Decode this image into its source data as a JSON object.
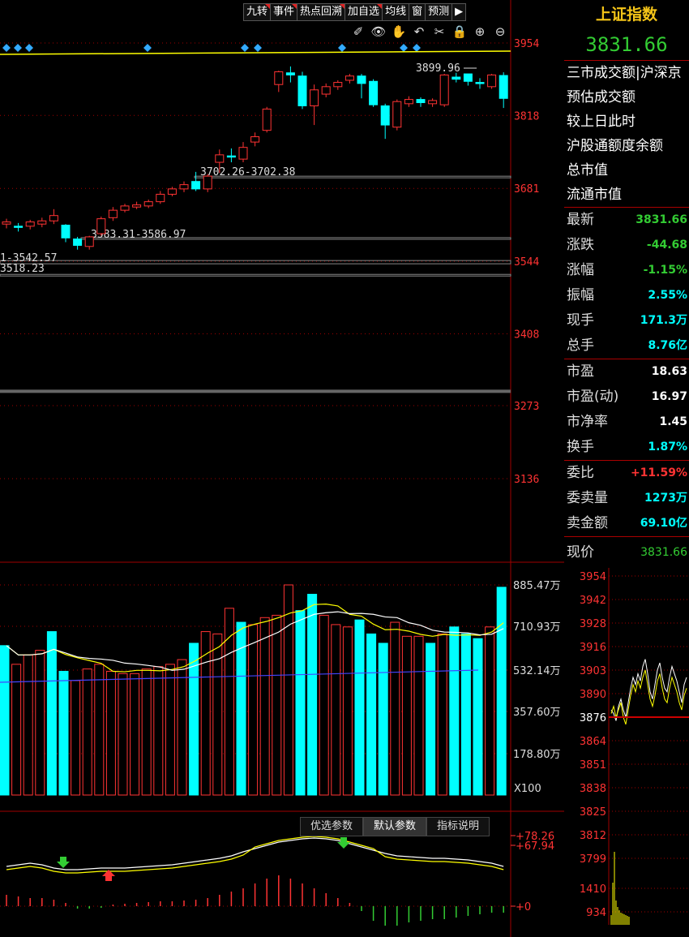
{
  "toolbar": {
    "buttons": [
      "九转",
      "事件",
      "热点回溯",
      "加自选",
      "均线",
      "窗",
      "预测"
    ],
    "tools": [
      "✐",
      "👁",
      "✋",
      "↶",
      "✂",
      "🔒",
      "⊕",
      "⊖"
    ]
  },
  "kline": {
    "price_axis": [
      "3954",
      "3818",
      "3681",
      "3544",
      "3408",
      "3273",
      "3136"
    ],
    "annotations": {
      "high": "3899.96",
      "gap1": "3702.26-3702.38",
      "gap2": "3583.31-3586.97",
      "gap3": "1-3542.57",
      "gap4": "3518.23"
    },
    "candles": [
      [
        3614,
        3618,
        3606,
        3624
      ],
      [
        3610,
        3608,
        3600,
        3616
      ],
      [
        3610,
        3618,
        3604,
        3622
      ],
      [
        3614,
        3620,
        3608,
        3626
      ],
      [
        3620,
        3630,
        3614,
        3642
      ],
      [
        3612,
        3588,
        3580,
        3614
      ],
      [
        3586,
        3574,
        3566,
        3590
      ],
      [
        3572,
        3590,
        3566,
        3592
      ],
      [
        3596,
        3624,
        3592,
        3628
      ],
      [
        3626,
        3640,
        3620,
        3646
      ],
      [
        3640,
        3648,
        3636,
        3652
      ],
      [
        3646,
        3650,
        3642,
        3656
      ],
      [
        3648,
        3656,
        3644,
        3660
      ],
      [
        3656,
        3670,
        3652,
        3676
      ],
      [
        3670,
        3680,
        3666,
        3684
      ],
      [
        3680,
        3688,
        3674,
        3694
      ],
      [
        3694,
        3680,
        3676,
        3712
      ],
      [
        3680,
        3704,
        3674,
        3708
      ],
      [
        3730,
        3744,
        3710,
        3754
      ],
      [
        3742,
        3740,
        3730,
        3756
      ],
      [
        3736,
        3758,
        3730,
        3768
      ],
      [
        3768,
        3778,
        3760,
        3786
      ],
      [
        3790,
        3830,
        3786,
        3834
      ],
      [
        3876,
        3900,
        3862,
        3902
      ],
      [
        3898,
        3894,
        3880,
        3910
      ],
      [
        3892,
        3836,
        3830,
        3900
      ],
      [
        3836,
        3866,
        3800,
        3876
      ],
      [
        3858,
        3872,
        3852,
        3878
      ],
      [
        3872,
        3880,
        3866,
        3884
      ],
      [
        3884,
        3892,
        3878,
        3896
      ],
      [
        3892,
        3878,
        3850,
        3896
      ],
      [
        3882,
        3838,
        3834,
        3886
      ],
      [
        3836,
        3800,
        3774,
        3840
      ],
      [
        3796,
        3844,
        3790,
        3848
      ],
      [
        3840,
        3848,
        3834,
        3854
      ],
      [
        3848,
        3842,
        3834,
        3852
      ],
      [
        3840,
        3846,
        3834,
        3850
      ],
      [
        3838,
        3894,
        3834,
        3896
      ],
      [
        3890,
        3886,
        3880,
        3898
      ],
      [
        3896,
        3882,
        3874,
        3896
      ],
      [
        3880,
        3878,
        3868,
        3888
      ],
      [
        3872,
        3894,
        3868,
        3896
      ],
      [
        3893,
        3850,
        3832,
        3899
      ]
    ]
  },
  "volume": {
    "axis": [
      "885.47万",
      "710.93万",
      "532.14万",
      "357.60万",
      "178.80万"
    ],
    "unit": "X100",
    "values": [
      640,
      560,
      600,
      620,
      700,
      530,
      490,
      540,
      560,
      530,
      520,
      520,
      540,
      550,
      560,
      580,
      650,
      700,
      690,
      800,
      740,
      730,
      760,
      770,
      900,
      790,
      860,
      770,
      730,
      720,
      750,
      690,
      650,
      740,
      680,
      680,
      650,
      690,
      720,
      690,
      670,
      720,
      890
    ],
    "up": [
      false,
      true,
      true,
      true,
      false,
      false,
      true,
      true,
      true,
      true,
      true,
      true,
      true,
      true,
      true,
      true,
      false,
      true,
      true,
      true,
      false,
      true,
      true,
      true,
      true,
      false,
      false,
      true,
      true,
      true,
      false,
      false,
      false,
      true,
      true,
      true,
      false,
      true,
      false,
      false,
      false,
      true,
      false
    ]
  },
  "indicator": {
    "tabs": [
      "优选参数",
      "默认参数",
      "指标说明"
    ],
    "active_tab": 1,
    "labels": [
      "+78.26",
      "+67.94",
      "+0"
    ]
  },
  "quote": {
    "title": "上证指数",
    "price": "3831.66",
    "info_lines": [
      "三市成交额|沪深京",
      "预估成交额",
      "较上日此时",
      "沪股通额度余额",
      "总市值",
      "流通市值"
    ],
    "stats1": [
      {
        "k": "最新",
        "v": "3831.66",
        "c": "down"
      },
      {
        "k": "涨跌",
        "v": "-44.68",
        "c": "down"
      },
      {
        "k": "涨幅",
        "v": "-1.15%",
        "c": "down"
      },
      {
        "k": "振幅",
        "v": "2.55%",
        "c": "cyan"
      },
      {
        "k": "现手",
        "v": "171.3万",
        "c": "cyan"
      },
      {
        "k": "总手",
        "v": "8.76亿",
        "c": "cyan"
      }
    ],
    "stats2": [
      {
        "k": "市盈",
        "v": "18.63",
        "c": "white"
      },
      {
        "k": "市盈(动)",
        "v": "16.97",
        "c": "white"
      },
      {
        "k": "市净率",
        "v": "1.45",
        "c": "white"
      },
      {
        "k": "换手",
        "v": "1.87%",
        "c": "cyan"
      }
    ],
    "stats3": [
      {
        "k": "委比",
        "v": "+11.59%",
        "c": "up"
      },
      {
        "k": "委卖量",
        "v": "1273万",
        "c": "cyan"
      },
      {
        "k": "卖金额",
        "v": "69.10亿",
        "c": "cyan"
      }
    ],
    "now_label": "现价",
    "now_value": "3831.66",
    "mini_axis": [
      "3954",
      "3942",
      "3928",
      "3916",
      "3903",
      "3890",
      "3876",
      "3864",
      "3851",
      "3838",
      "3825",
      "3812",
      "3799",
      "1410",
      "934"
    ],
    "mini_line1": [
      3880,
      3878,
      3874,
      3882,
      3886,
      3880,
      3876,
      3884,
      3892,
      3898,
      3894,
      3900,
      3896,
      3904,
      3908,
      3900,
      3890,
      3886,
      3894,
      3902,
      3906,
      3898,
      3892,
      3890,
      3898,
      3904,
      3900,
      3896,
      3890,
      3884,
      3894,
      3898
    ],
    "mini_line2": [
      3878,
      3882,
      3876,
      3880,
      3884,
      3876,
      3872,
      3880,
      3888,
      3894,
      3890,
      3896,
      3892,
      3898,
      3902,
      3894,
      3886,
      3882,
      3888,
      3896,
      3900,
      3892,
      3886,
      3884,
      3892,
      3898,
      3894,
      3890,
      3884,
      3880,
      3888,
      3892
    ],
    "mini_volume": [
      120,
      520,
      900,
      300,
      220,
      180,
      150,
      140,
      130,
      120,
      110,
      100
    ]
  },
  "colors": {
    "up": "#ff3333",
    "down": "#00ffff",
    "ma5": "#ffff00",
    "ma10": "#ffffff",
    "ma20": "#4444ff",
    "grid": "#a00000"
  }
}
